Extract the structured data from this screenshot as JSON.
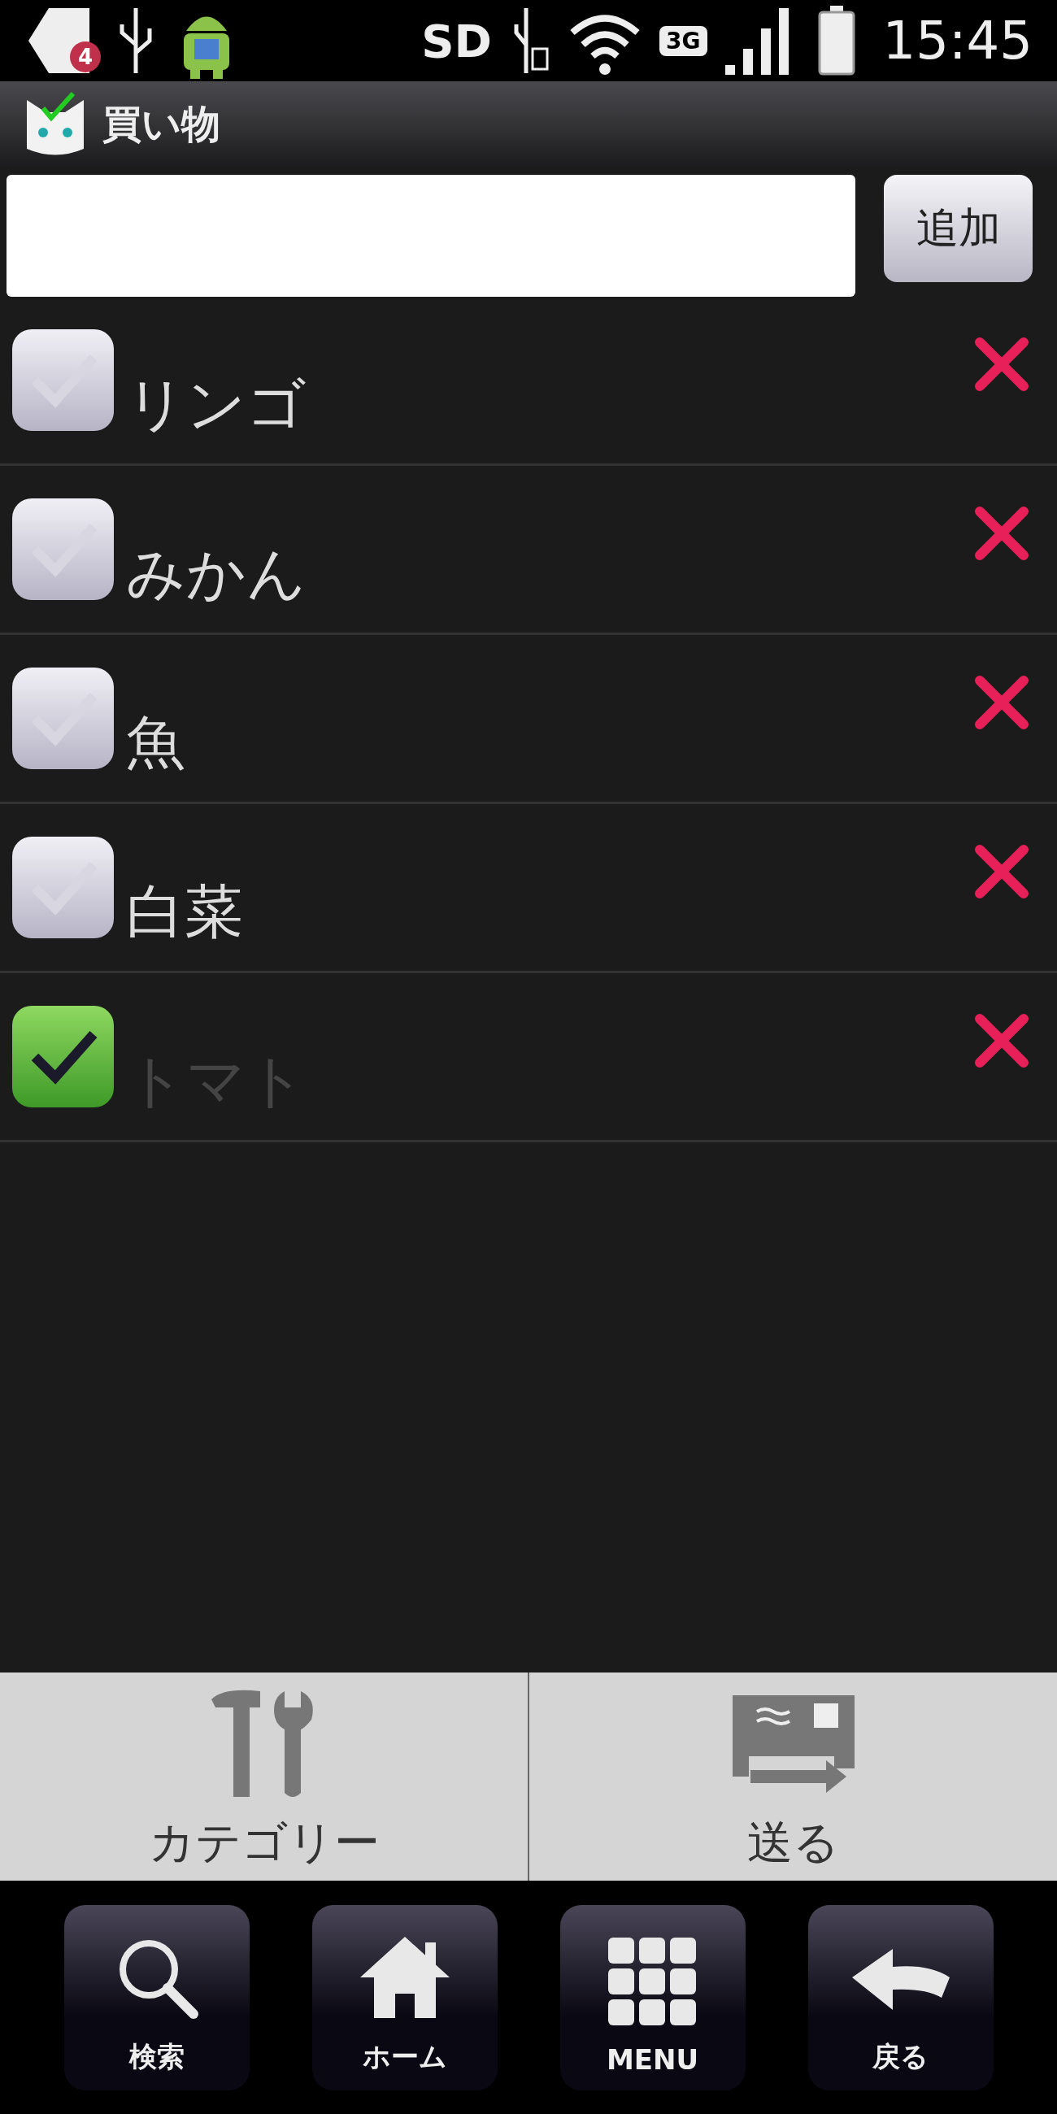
{
  "status_bar": {
    "notification_count": "4",
    "sd": "SD",
    "network": "3G",
    "time": "15:45"
  },
  "app_bar": {
    "title": "買い物"
  },
  "add_form": {
    "button": "追加"
  },
  "items": [
    {
      "name": "リンゴ",
      "checked": false
    },
    {
      "name": "みかん",
      "checked": false
    },
    {
      "name": "魚",
      "checked": false
    },
    {
      "name": "白菜",
      "checked": false
    },
    {
      "name": "トマト",
      "checked": true
    }
  ],
  "actions": [
    {
      "kind": "tools",
      "label": "カテゴリー"
    },
    {
      "kind": "send",
      "label": "送る"
    }
  ],
  "nav": [
    {
      "kind": "search",
      "label": "検索"
    },
    {
      "kind": "home",
      "label": "ホーム"
    },
    {
      "kind": "menu",
      "label": "MENU"
    },
    {
      "kind": "back",
      "label": "戻る"
    }
  ]
}
